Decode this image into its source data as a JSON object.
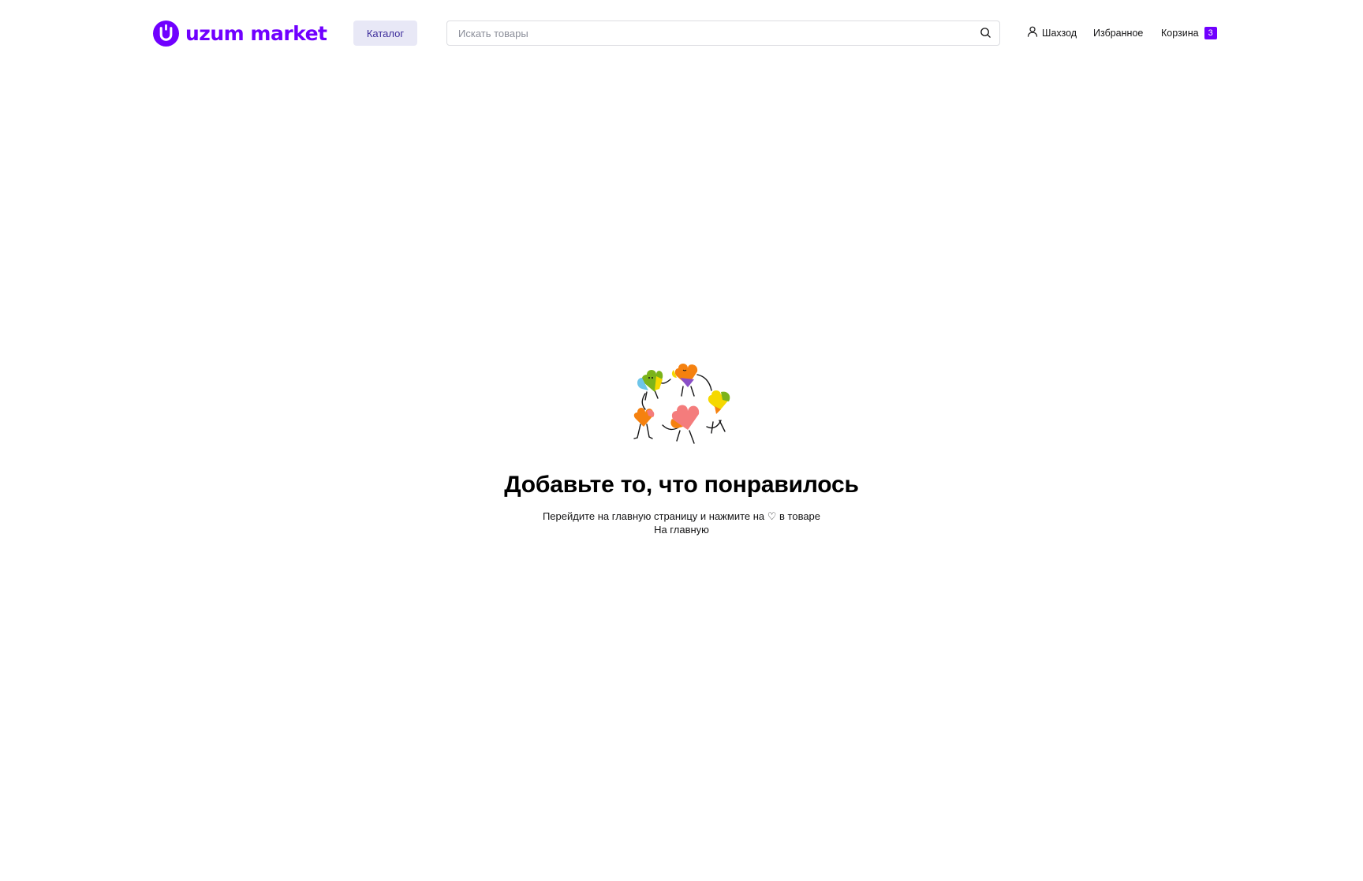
{
  "header": {
    "logo_text": "uzum market",
    "catalog_label": "Каталог",
    "search_placeholder": "Искать товары",
    "user_label": "Шахзод",
    "favorites_label": "Избранное",
    "cart_label": "Корзина",
    "cart_count": "3"
  },
  "empty_state": {
    "title": "Добавьте то, что понравилось",
    "text": "Перейдите на главную страницу и нажмите на ♡ в товаре",
    "link_label": "На главную"
  },
  "colors": {
    "brand": "#7000ff",
    "catalog_bg": "#e8e8f6",
    "catalog_text": "#3d2d9b"
  },
  "icons": {
    "logo": "uzum-logo-icon",
    "search": "search-icon",
    "user": "user-icon",
    "illustration": "dancing-hearts-illustration"
  }
}
